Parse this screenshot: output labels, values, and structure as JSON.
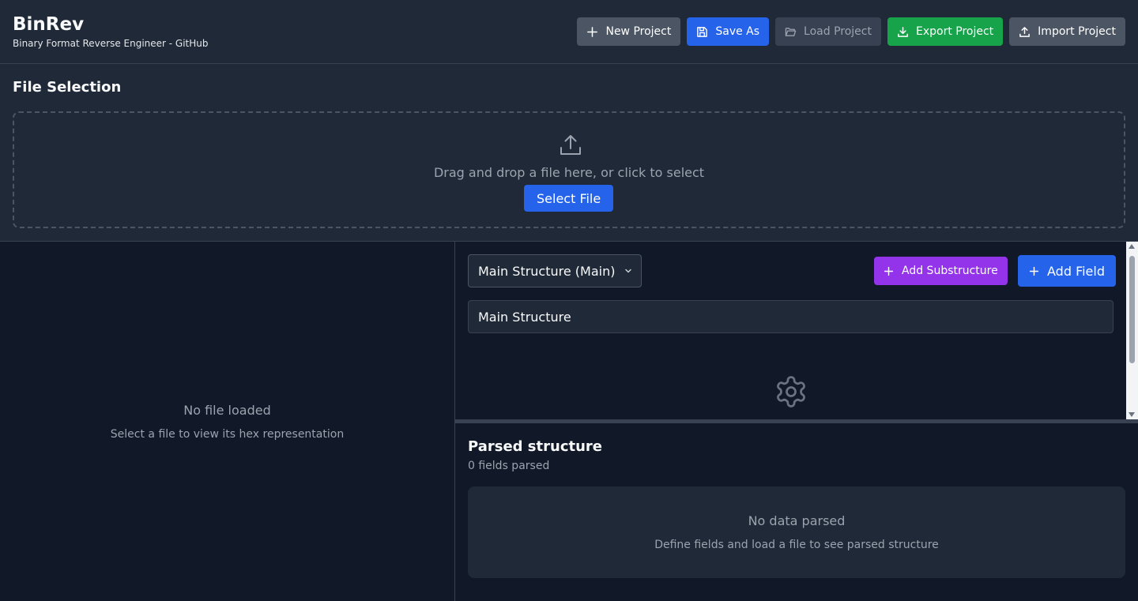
{
  "app": {
    "title": "BinRev",
    "subtitle": "Binary Format Reverse Engineer - GitHub"
  },
  "toolbar": {
    "new_project": {
      "label": "New Project",
      "icon": "plus-icon"
    },
    "save_as": {
      "label": "Save As",
      "icon": "save-icon"
    },
    "load_project": {
      "label": "Load Project",
      "icon": "folder-open-icon",
      "disabled": true
    },
    "export_project": {
      "label": "Export Project",
      "icon": "download-icon"
    },
    "import_project": {
      "label": "Import Project",
      "icon": "upload-icon"
    }
  },
  "file_selection": {
    "title": "File Selection",
    "drop_text": "Drag and drop a file here, or click to select",
    "select_button": "Select File"
  },
  "hex_view": {
    "empty_title": "No file loaded",
    "empty_subtitle": "Select a file to view its hex representation"
  },
  "structure_editor": {
    "selected_structure": "Main Structure (Main)",
    "add_substructure": "Add Substructure",
    "add_field": "Add Field",
    "structure_name_value": "Main Structure"
  },
  "parsed": {
    "title": "Parsed structure",
    "count": "0 fields parsed",
    "empty_title": "No data parsed",
    "empty_subtitle": "Define fields and load a file to see parsed structure"
  },
  "colors": {
    "primary": "#2563eb",
    "success": "#16a34a",
    "accent": "#9333ea",
    "neutral": "#4b5563",
    "background": "#111827",
    "surface": "#1f2937"
  }
}
